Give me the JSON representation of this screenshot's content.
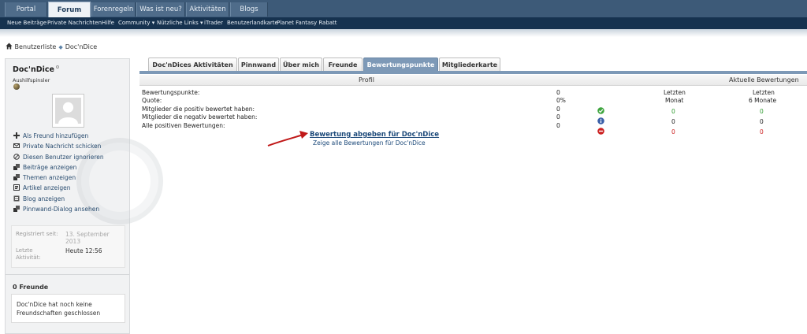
{
  "nav": {
    "tabs": [
      {
        "label": "Portal"
      },
      {
        "label": "Forum"
      },
      {
        "label": "Forenregeln"
      },
      {
        "label": "Was ist neu?"
      },
      {
        "label": "Aktivitäten"
      },
      {
        "label": "Blogs"
      }
    ],
    "sublinks": [
      {
        "label": "Neue Beiträge"
      },
      {
        "label": "Private Nachrichten"
      },
      {
        "label": "Hilfe"
      },
      {
        "label": "Community ▾"
      },
      {
        "label": "Nützliche Links ▾"
      },
      {
        "label": "iTrader"
      },
      {
        "label": "Benutzerlandkarte"
      },
      {
        "label": "Planet Fantasy Rabatt"
      }
    ]
  },
  "breadcrumb": {
    "first": "Benutzerliste",
    "current": "Doc'nDice"
  },
  "sidebar": {
    "username": "Doc'nDice",
    "usertitle": "Aushilfspinsler",
    "menu": [
      {
        "label": "Als Freund hinzufügen",
        "icon": "plus-icon"
      },
      {
        "label": "Private Nachricht schicken",
        "icon": "envelope-icon"
      },
      {
        "label": "Diesen Benutzer ignorieren",
        "icon": "block-icon"
      },
      {
        "label": "Beiträge anzeigen",
        "icon": "posts-icon"
      },
      {
        "label": "Themen anzeigen",
        "icon": "threads-icon"
      },
      {
        "label": "Artikel anzeigen",
        "icon": "article-icon"
      },
      {
        "label": "Blog anzeigen",
        "icon": "blog-icon"
      },
      {
        "label": "Pinnwand-Dialog ansehen",
        "icon": "wall-icon"
      }
    ],
    "registered_label": "Registriert seit:",
    "registered_value": "13. September 2013",
    "last_activity_label": "Letzte Aktivität:",
    "last_activity_value": "Heute 12:56",
    "friends_header": "0 Freunde",
    "friends_text": "Doc'nDice hat noch keine Freundschaften geschlossen"
  },
  "profile_tabs": [
    {
      "label": "Doc'nDices Aktivitäten"
    },
    {
      "label": "Pinnwand"
    },
    {
      "label": "Über mich"
    },
    {
      "label": "Freunde"
    },
    {
      "label": "Bewertungspunkte"
    },
    {
      "label": "Mitgliederkarte"
    }
  ],
  "reputation": {
    "header_profile": "Profil",
    "header_recent": "Aktuelle Bewertungen",
    "rows": [
      {
        "label": "Bewertungspunkte:",
        "value": "0"
      },
      {
        "label": "Quote:",
        "value": "0%"
      },
      {
        "label": "Mitglieder die positiv bewertet haben:",
        "value": "0"
      },
      {
        "label": "Mitglieder die negativ bewertet haben:",
        "value": "0"
      },
      {
        "label": "Alle positiven Bewertungen:",
        "value": "0"
      }
    ],
    "col_month_line1": "Letzten",
    "col_month_line2": "Monat",
    "col_6m_line1": "Letzten",
    "col_6m_line2": "6 Monate",
    "positive": {
      "month": "0",
      "six": "0"
    },
    "neutral": {
      "month": "0",
      "six": "0"
    },
    "negative": {
      "month": "0",
      "six": "0"
    },
    "give_link": "Bewertung abgeben für Doc'nDice",
    "show_link": "Zeige alle Bewertungen für Doc'nDice"
  },
  "colors": {
    "nav": "#3d5a78",
    "subnav": "#16324f",
    "tab_active": "#7d99b7",
    "link": "#1d4a7a",
    "positive": "#2f9a2f",
    "negative": "#cc2222",
    "neutral": "#3a5fa8"
  }
}
